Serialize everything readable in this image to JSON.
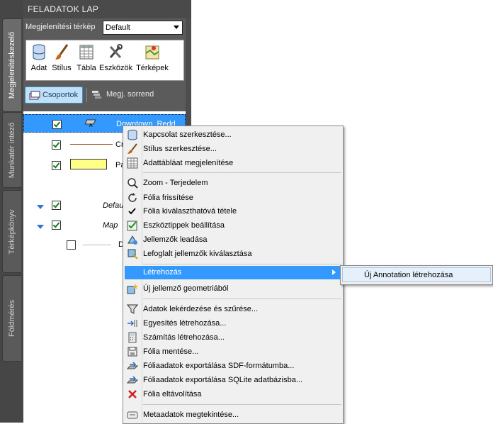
{
  "palette": {
    "title": "FELADATOK LAP",
    "vertical_tabs": [
      "Megjelenítéskezelő",
      "Munkatér intéző",
      "Térképkönyv",
      "Földmérés"
    ],
    "map_label": "Megjelenítési térkép",
    "map_select_value": "Default",
    "tools": [
      {
        "label": "Adat",
        "icon": "database-icon"
      },
      {
        "label": "Stílus",
        "icon": "brush-icon"
      },
      {
        "label": "Tábla",
        "icon": "table-icon"
      },
      {
        "label": "Eszközök",
        "icon": "tools-icon"
      },
      {
        "label": "Térképek",
        "icon": "map-icon"
      }
    ],
    "groups_button": "Csoportok",
    "draw_order_button": "Megj. sorrend",
    "layers": [
      {
        "name": "Downtown_Redd",
        "checked": true,
        "selected": true
      },
      {
        "name": "Cr",
        "checked": true
      },
      {
        "name": "Pa",
        "checked": true
      },
      {
        "name": "Defau",
        "checked": true,
        "group": true
      },
      {
        "name": "Map",
        "checked": true,
        "group": true
      },
      {
        "name": "D",
        "checked": false
      }
    ]
  },
  "context_menu": {
    "items": [
      {
        "label": "Kapcsolat szerkesztése...",
        "icon": "database-icon"
      },
      {
        "label": "Stílus szerkesztése...",
        "icon": "brush-icon"
      },
      {
        "label": "Adattábláat megjelenítése",
        "icon": "table-icon"
      },
      {
        "label": "Zoom - Terjedelem",
        "icon": "zoom-icon"
      },
      {
        "label": "Fólia frissítése",
        "icon": "refresh-icon"
      },
      {
        "label": "Fólia kiválaszthatóvá tétele",
        "icon": "check-icon"
      },
      {
        "label": "Eszköztippek beállítása",
        "icon": "checkbox-icon"
      },
      {
        "label": "Jellemzők leadása",
        "icon": "release-icon"
      },
      {
        "label": "Lefoglalt jellemzők kiválasztása",
        "icon": "select-locked-icon"
      },
      {
        "label": "Létrehozás",
        "icon": ""
      },
      {
        "label": "Új jellemző geometriából",
        "icon": "new-feature-icon"
      },
      {
        "label": "Adatok lekérdezése és szűrése...",
        "icon": "filter-icon"
      },
      {
        "label": "Egyesítés létrehozása...",
        "icon": "join-icon"
      },
      {
        "label": "Számítás létrehozása...",
        "icon": "calculator-icon"
      },
      {
        "label": "Fólia mentése...",
        "icon": "save-layer-icon"
      },
      {
        "label": "Fóliaadatok exportálása SDF-formátumba...",
        "icon": "export-sdf-icon"
      },
      {
        "label": "Fóliaadatok exportálása SQLite adatbázisba...",
        "icon": "export-sqlite-icon"
      },
      {
        "label": "Fólia eltávolítása",
        "icon": "delete-icon"
      },
      {
        "label": "Metaadatok megtekintése...",
        "icon": "metadata-icon"
      }
    ],
    "submenu_item": "Új Annotation létrehozása"
  },
  "colors": {
    "highlight": "#3399ff",
    "palette_bg": "#4d4d4d"
  }
}
